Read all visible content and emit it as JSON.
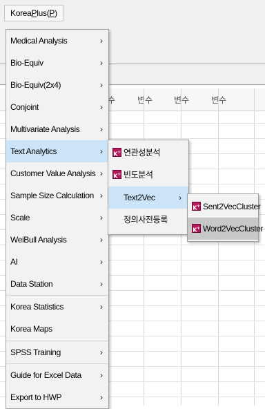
{
  "menubar": {
    "menu_prefix": "Korea",
    "menu_underlined": "P",
    "menu_mid": "lus(",
    "menu_suffix": ")"
  },
  "sheet": {
    "column_headers": [
      "변수",
      "변수",
      "변수",
      "변수"
    ]
  },
  "main_menu": {
    "items": [
      {
        "label": "Medical Analysis",
        "has_submenu": true
      },
      {
        "label": "Bio-Equiv",
        "has_submenu": true
      },
      {
        "label": "Bio-Equiv(2x4)",
        "has_submenu": true
      },
      {
        "label": "Conjoint",
        "has_submenu": true
      },
      {
        "label": "Multivariate Analysis",
        "has_submenu": true
      },
      {
        "label": "Text Analytics",
        "has_submenu": true,
        "highlighted": true
      },
      {
        "label": "Customer Value Analysis",
        "has_submenu": true
      },
      {
        "label": "Sample Size Calculation",
        "has_submenu": true
      },
      {
        "label": "Scale",
        "has_submenu": true
      },
      {
        "label": "WeiBull Analysis",
        "has_submenu": true
      },
      {
        "label": "AI",
        "has_submenu": true
      },
      {
        "label": "Data Station",
        "has_submenu": true
      },
      {
        "label": "Korea Statistics",
        "has_submenu": true
      },
      {
        "label": "Korea Maps",
        "has_submenu": false
      },
      {
        "label": "SPSS Training",
        "has_submenu": true
      },
      {
        "label": "Guide for Excel Data",
        "has_submenu": true
      },
      {
        "label": "Export to HWP",
        "has_submenu": true
      }
    ],
    "arrow_glyph": "›"
  },
  "text_analytics_menu": {
    "items": [
      {
        "label": "연관성분석",
        "icon": "kp-app-icon"
      },
      {
        "label": "빈도분석",
        "icon": "kp-app-icon"
      },
      {
        "label": "Text2Vec",
        "has_submenu": true,
        "highlighted": true
      },
      {
        "label": "정의사전등록"
      }
    ]
  },
  "text2vec_menu": {
    "items": [
      {
        "label": "Sent2VecCluster",
        "icon": "kp-app-icon"
      },
      {
        "label": "Word2VecCluster",
        "icon": "kp-app-icon",
        "highlighted": true
      }
    ]
  },
  "icon_text": {
    "main": "K",
    "sup": "+"
  },
  "colors": {
    "highlight": "#cce4f7",
    "hover": "#c8c8c8",
    "icon": "#b2185a"
  }
}
